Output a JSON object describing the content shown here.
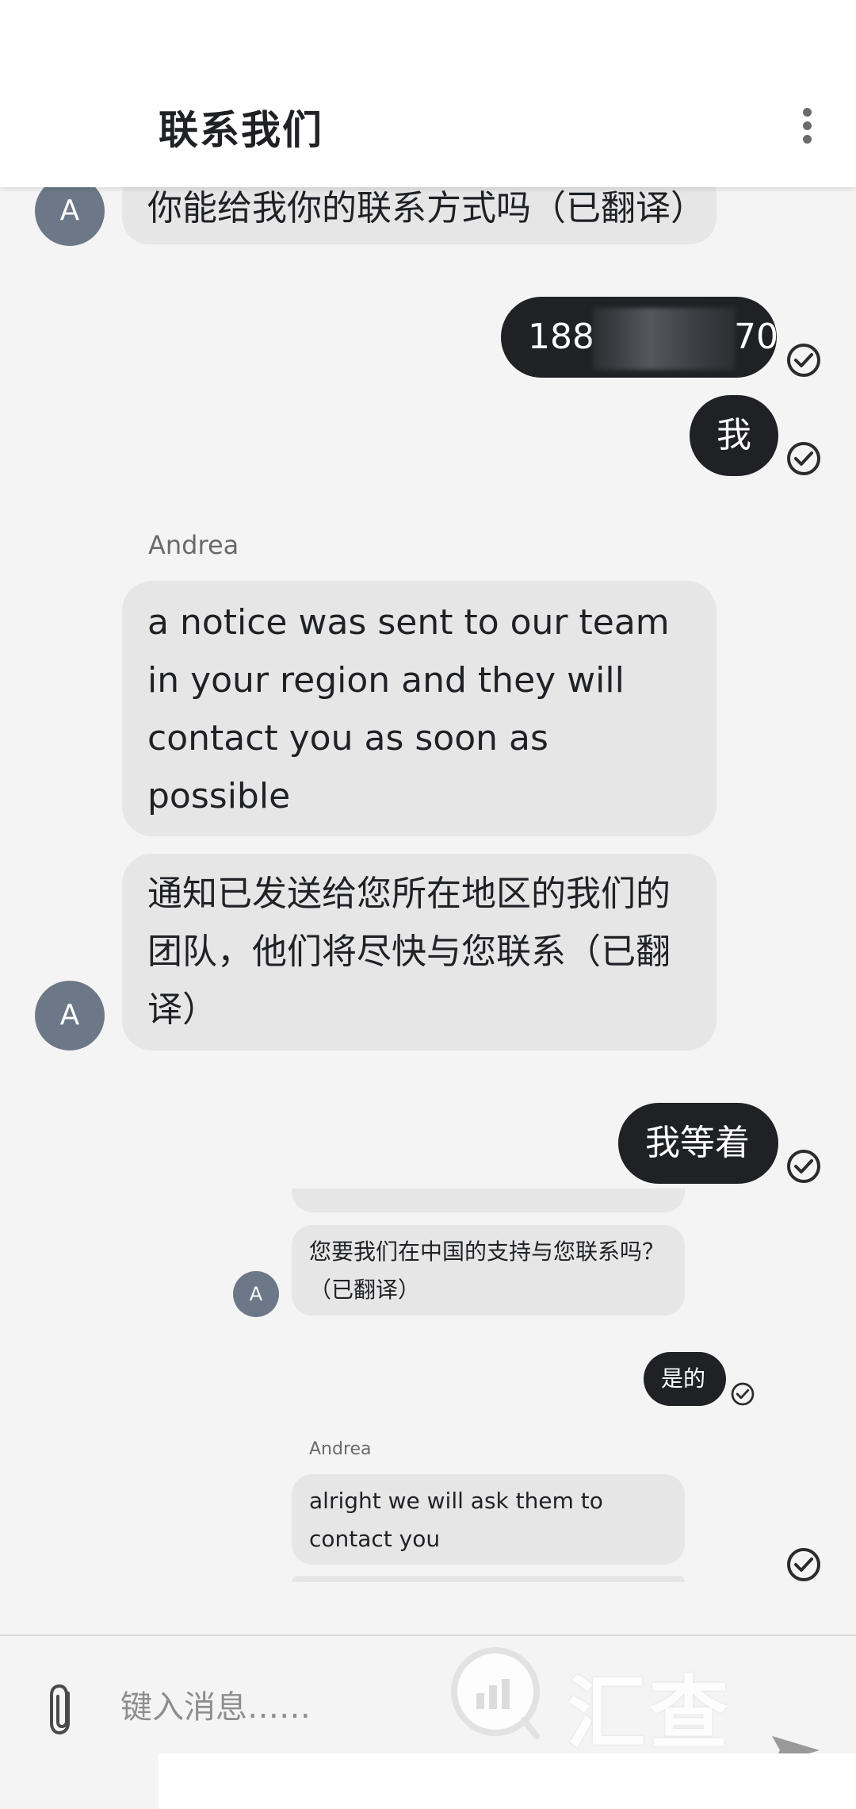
{
  "header": {
    "title": "联系我们",
    "more_icon": "more-vert-icon"
  },
  "messages": {
    "m1": {
      "avatar": "A",
      "text": "你能给我你的联系方式吗（已翻译）"
    },
    "m2": {
      "prefix": "188",
      "suffix": "70",
      "note": "middle digits blurred"
    },
    "m3": {
      "text": "我"
    },
    "m4": {
      "sender": "Andrea",
      "text": "a notice was sent to our team in your region and they will contact you as soon as possible"
    },
    "m5": {
      "avatar": "A",
      "text": "通知已发送给您所在地区的我们的团队，他们将尽快与您联系（已翻译）"
    },
    "m6": {
      "text": "我等着"
    },
    "m7": {
      "avatar": "A",
      "text": "您要我们在中国的支持与您联系吗？（已翻译）"
    },
    "m8": {
      "text": "是的"
    },
    "m9": {
      "sender": "Andrea",
      "text": "alright we will ask them to contact you"
    }
  },
  "input": {
    "placeholder": "键入消息……",
    "attach_icon": "paperclip-icon",
    "send_icon": "send-icon"
  },
  "watermark": {
    "text": "汇查查"
  },
  "colors": {
    "background": "#f4f4f5",
    "incoming_bubble": "#e6e6e7",
    "outgoing_bubble": "#1f2125",
    "avatar": "#6c7887"
  }
}
